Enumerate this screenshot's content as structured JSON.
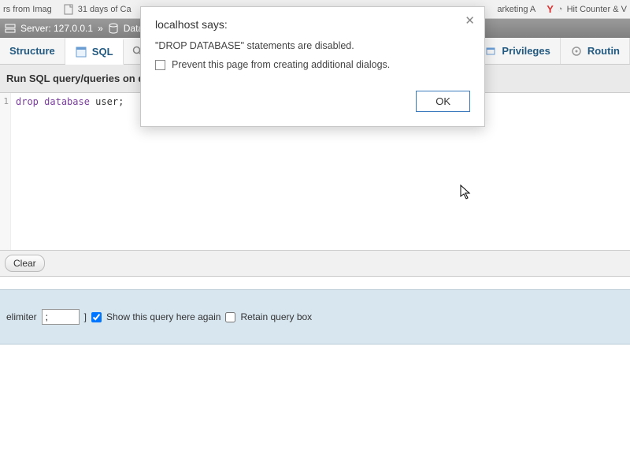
{
  "browserTabs": {
    "t0": "rs from Imag",
    "t1": "31 days of Ca",
    "t3": "arketing A",
    "t4": "Hit Counter & V"
  },
  "serverBar": {
    "label": "Server: 127.0.0.1",
    "sep": "»",
    "dbLabel": "Databa"
  },
  "tabs": {
    "structure": "Structure",
    "sql": "SQL",
    "privileges": "Privileges",
    "routines": "Routin"
  },
  "content": {
    "heading": "Run SQL query/queries on da"
  },
  "editor": {
    "lineNum": "1",
    "code_kw1": "drop",
    "code_kw2": "database",
    "code_kw3": "user",
    "code_end": ";"
  },
  "buttons": {
    "clear": "Clear"
  },
  "delimiter": {
    "label": "elimiter",
    "value": ";",
    "bracket": "]",
    "showAgain": "Show this query here again",
    "retain": "Retain query box"
  },
  "modal": {
    "title": "localhost says:",
    "message": "\"DROP DATABASE\" statements are disabled.",
    "checkbox": "Prevent this page from creating additional dialogs.",
    "ok": "OK"
  }
}
